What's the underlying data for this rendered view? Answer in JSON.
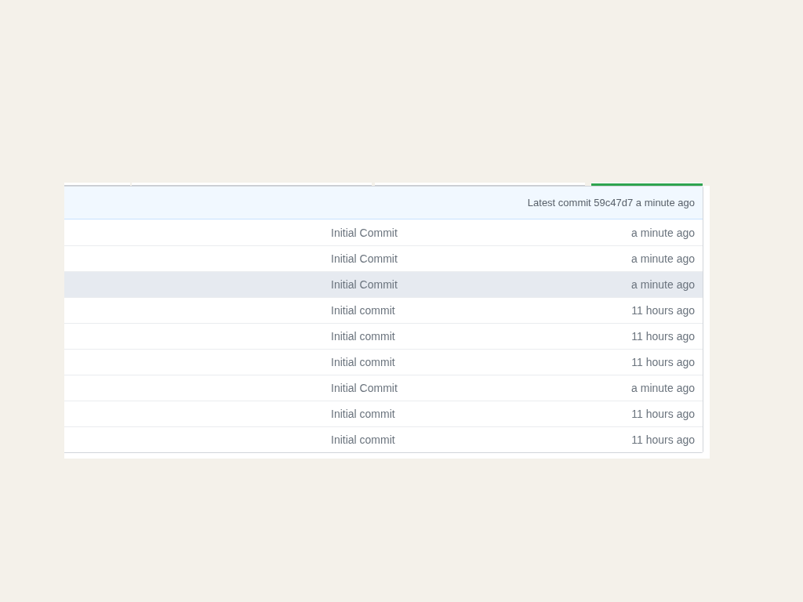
{
  "commit_header": {
    "text": "Latest commit 59c47d7 a minute ago"
  },
  "rows": [
    {
      "message": "Initial Commit",
      "age": "a minute ago",
      "selected": false
    },
    {
      "message": "Initial Commit",
      "age": "a minute ago",
      "selected": false
    },
    {
      "message": "Initial Commit",
      "age": "a minute ago",
      "selected": true
    },
    {
      "message": "Initial commit",
      "age": "11 hours ago",
      "selected": false
    },
    {
      "message": "Initial commit",
      "age": "11 hours ago",
      "selected": false
    },
    {
      "message": "Initial commit",
      "age": "11 hours ago",
      "selected": false
    },
    {
      "message": "Initial Commit",
      "age": "a minute ago",
      "selected": false
    },
    {
      "message": "Initial commit",
      "age": "11 hours ago",
      "selected": false
    },
    {
      "message": "Initial commit",
      "age": "11 hours ago",
      "selected": false
    }
  ]
}
